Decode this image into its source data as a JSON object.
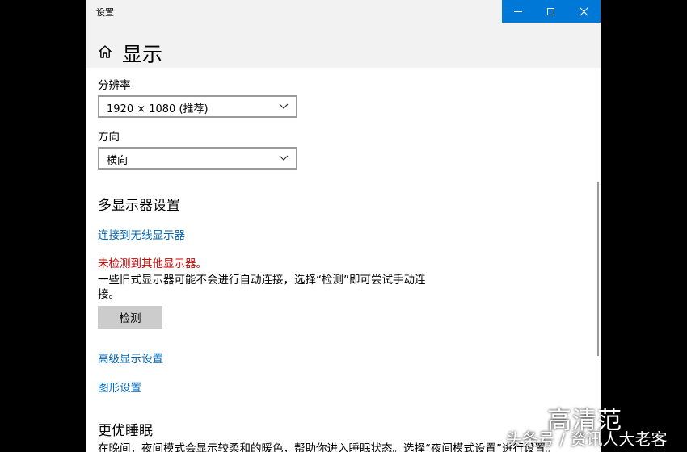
{
  "window": {
    "app_title": "设置",
    "controls": {
      "minimize": "—",
      "maximize": "□",
      "close": "✕"
    }
  },
  "header": {
    "title": "显示",
    "home_icon": "home-icon"
  },
  "resolution": {
    "label": "分辨率",
    "value": "1920 × 1080 (推荐)"
  },
  "orientation": {
    "label": "方向",
    "value": "横向"
  },
  "multi_display": {
    "title": "多显示器设置",
    "wireless_link": "连接到无线显示器",
    "error": "未检测到其他显示器。",
    "description": "一些旧式显示器可能不会进行自动连接，选择“检测”即可尝试手动连接。",
    "detect_button": "检测"
  },
  "links": {
    "advanced": "高级显示设置",
    "graphics": "图形设置"
  },
  "night_light": {
    "title": "更优睡眠",
    "description": "在晚间，夜间模式会显示较柔和的暖色，帮助你进入睡眠状态。选择“夜间模式设置”进行设置。"
  },
  "watermarks": {
    "quality": "高清范",
    "source": "头条号 / 资讯人大老客"
  },
  "colors": {
    "accent": "#0078d7",
    "link": "#0063b1",
    "error": "#cc0000"
  }
}
